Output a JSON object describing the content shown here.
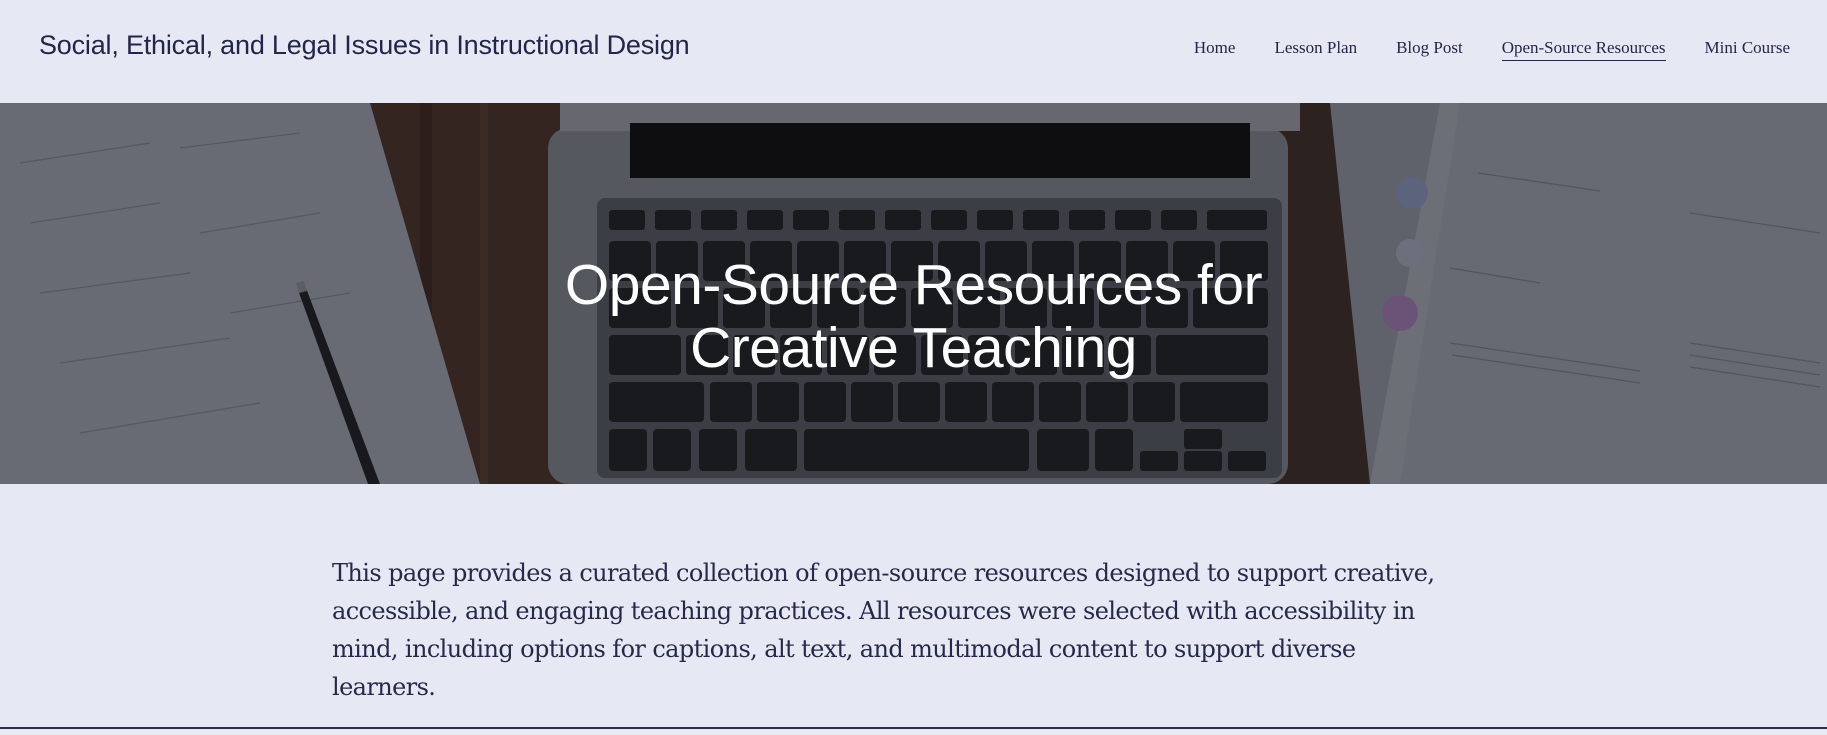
{
  "header": {
    "site_title": "Social, Ethical, and Legal Issues in Instructional Design",
    "nav": [
      {
        "label": "Home",
        "active": false
      },
      {
        "label": "Lesson Plan",
        "active": false
      },
      {
        "label": "Blog Post",
        "active": false
      },
      {
        "label": "Open-Source Resources",
        "active": true
      },
      {
        "label": "Mini Course",
        "active": false
      }
    ]
  },
  "hero": {
    "title_line1": "Open-Source Resources for",
    "title_line2": "Creative Teaching"
  },
  "intro": {
    "text": "This page provides a curated collection of open-source resources designed to support creative, accessible, and engaging teaching practices. All resources were selected with accessibility in mind, including options for captions, alt text, and multimodal content to support diverse learners."
  },
  "colors": {
    "background": "#e6e9f3",
    "text": "#22264a",
    "hero_title": "#ffffff"
  }
}
